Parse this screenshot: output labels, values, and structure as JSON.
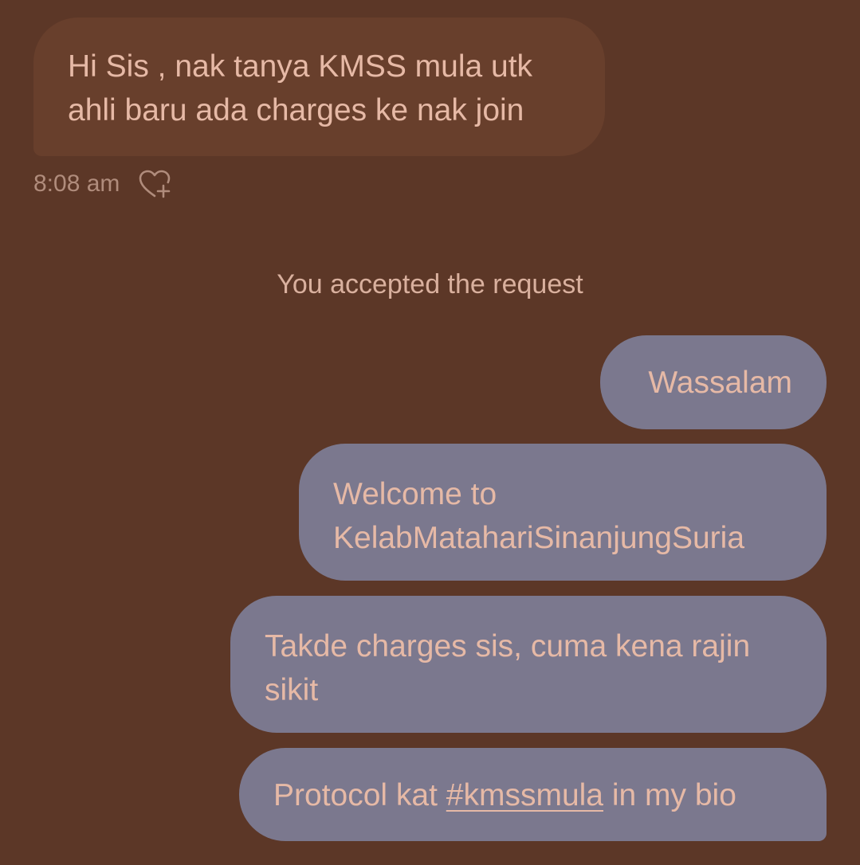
{
  "incoming_message": {
    "lines": [
      "Hi Sis , nak tanya KMSS mula utk",
      "ahli baru ada charges ke nak join"
    ],
    "time": "8:08 am",
    "react_icon": "heart-plus-icon"
  },
  "system_notice": "You accepted the request",
  "outgoing_messages": [
    {
      "lines": [
        "Wassalam"
      ]
    },
    {
      "lines": [
        "Welcome to",
        "KelabMatahariSinanjungSuria"
      ]
    },
    {
      "lines": [
        "Takde charges sis, cuma kena rajin",
        "sikit"
      ]
    },
    {
      "prefix": "Protocol kat ",
      "hashtag": "#kmssmula",
      "suffix": " in my bio"
    }
  ],
  "colors": {
    "background": "#5c3727",
    "incoming_bubble": "#683f2c",
    "outgoing_bubble": "#7b788e",
    "text": "#e6b9a6"
  }
}
